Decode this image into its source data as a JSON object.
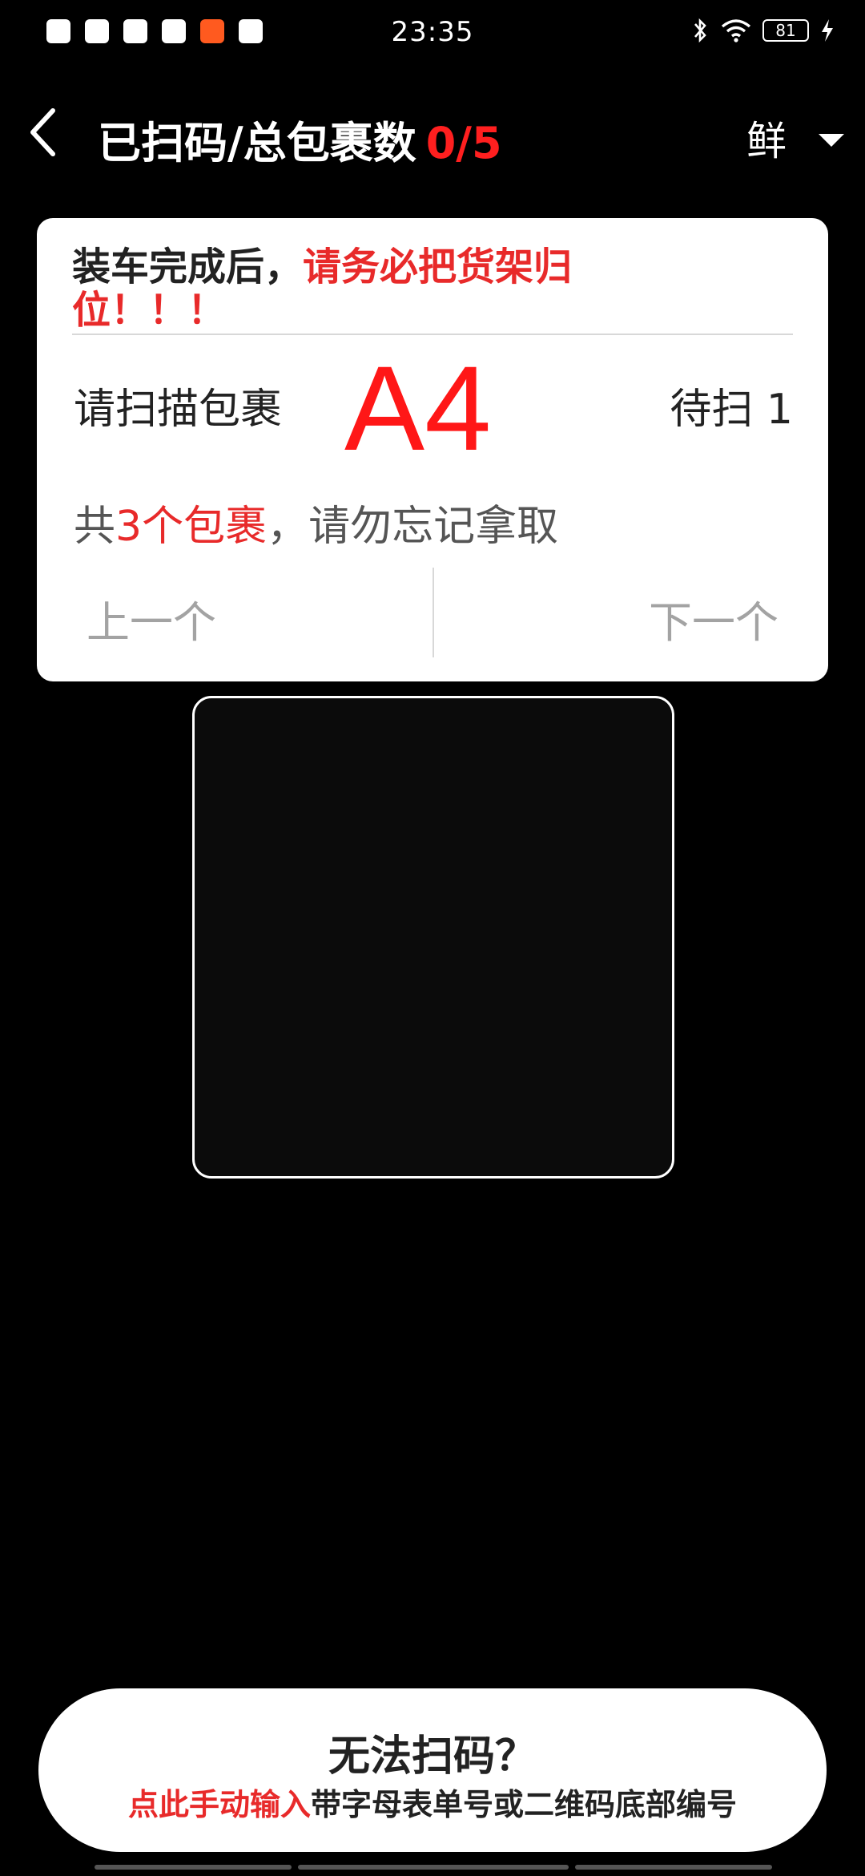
{
  "status_bar": {
    "time": "23:35",
    "battery": "81"
  },
  "header": {
    "title": "已扫码/总包裹数",
    "count": "0/5",
    "filter_label": "鲜"
  },
  "card": {
    "warning_black": "装车完成后，",
    "warning_red": "请务必把货架归位！！！",
    "scan_prompt": "请扫描包裹",
    "shelf_code": "A4",
    "pending": "待扫 1",
    "note_prefix": "共",
    "note_highlight": "3个包裹",
    "note_suffix": "，请勿忘记拿取",
    "prev_label": "上一个",
    "next_label": "下一个"
  },
  "manual_input": {
    "title": "无法扫码？",
    "action": "点此手动输入",
    "hint": "带字母表单号或二维码底部编号"
  },
  "colors": {
    "accent_red": "#e82a2a",
    "code_red": "#ff1717",
    "background": "#000000"
  }
}
